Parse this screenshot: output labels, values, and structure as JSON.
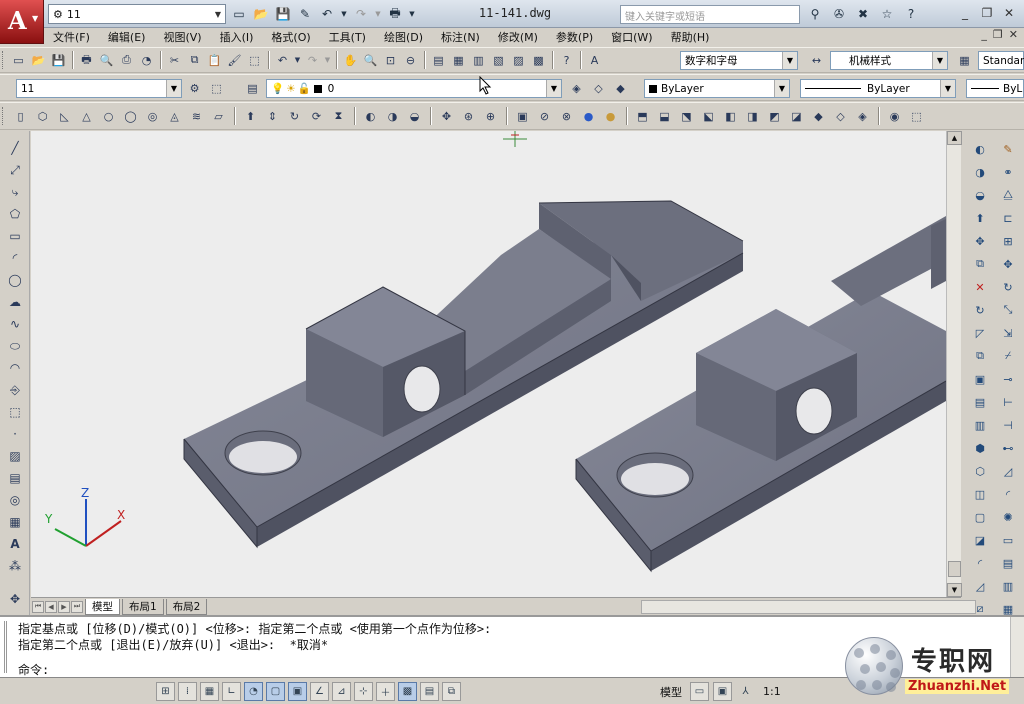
{
  "titlebar": {
    "workspace": "11",
    "document_title": "11-141.dwg",
    "search_placeholder": "键入关键字或短语"
  },
  "menu": [
    "文件(F)",
    "编辑(E)",
    "视图(V)",
    "插入(I)",
    "格式(O)",
    "工具(T)",
    "绘图(D)",
    "标注(N)",
    "修改(M)",
    "参数(P)",
    "窗口(W)",
    "帮助(H)"
  ],
  "toolbar_standard": {
    "text_style": "数字和字母",
    "dim_style": "机械样式",
    "table_style": "Standar"
  },
  "toolbar_layers": {
    "workspace_combo": "11",
    "layer_value": "0",
    "color": "ByLayer",
    "linetype": "ByLayer",
    "lineweight": "ByL"
  },
  "tabs": [
    "模型",
    "布局1",
    "布局2"
  ],
  "command": {
    "line1": "指定基点或 [位移(D)/模式(O)] <位移>: 指定第二个点或 <使用第一个点作为位移>:",
    "line2": "指定第二个点或 [退出(E)/放弃(U)] <退出>:  *取消*",
    "prompt": "命令:"
  },
  "status": {
    "model_label": "模型",
    "scale": "1:1"
  },
  "watermark": {
    "cn": "专职网",
    "en": "Zhuanzhi.Net"
  },
  "ucs": {
    "x": "X",
    "y": "Y",
    "z": "Z"
  },
  "colors": {
    "viewport_bg": "#ededed",
    "part_dark": "#5e6170",
    "part_mid": "#6e7180",
    "part_light": "#7e8190"
  }
}
